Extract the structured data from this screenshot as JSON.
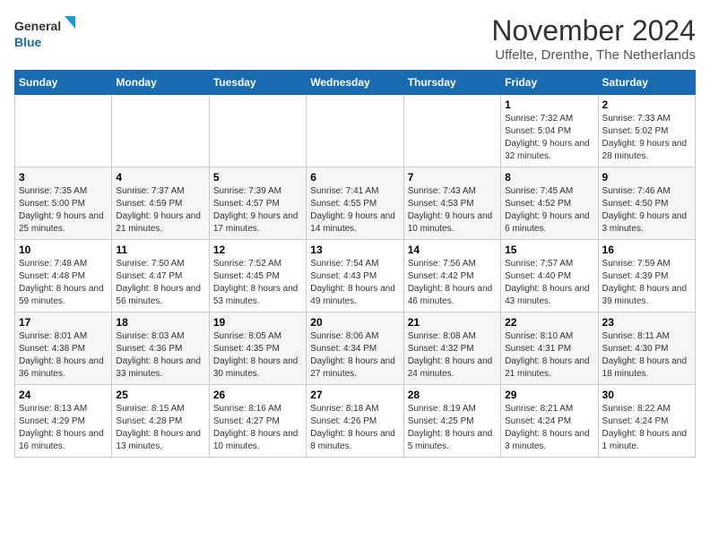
{
  "logo": {
    "line1": "General",
    "line2": "Blue"
  },
  "title": "November 2024",
  "location": "Uffelte, Drenthe, The Netherlands",
  "days_of_week": [
    "Sunday",
    "Monday",
    "Tuesday",
    "Wednesday",
    "Thursday",
    "Friday",
    "Saturday"
  ],
  "weeks": [
    [
      {
        "day": "",
        "info": ""
      },
      {
        "day": "",
        "info": ""
      },
      {
        "day": "",
        "info": ""
      },
      {
        "day": "",
        "info": ""
      },
      {
        "day": "",
        "info": ""
      },
      {
        "day": "1",
        "info": "Sunrise: 7:32 AM\nSunset: 5:04 PM\nDaylight: 9 hours and 32 minutes."
      },
      {
        "day": "2",
        "info": "Sunrise: 7:33 AM\nSunset: 5:02 PM\nDaylight: 9 hours and 28 minutes."
      }
    ],
    [
      {
        "day": "3",
        "info": "Sunrise: 7:35 AM\nSunset: 5:00 PM\nDaylight: 9 hours and 25 minutes."
      },
      {
        "day": "4",
        "info": "Sunrise: 7:37 AM\nSunset: 4:59 PM\nDaylight: 9 hours and 21 minutes."
      },
      {
        "day": "5",
        "info": "Sunrise: 7:39 AM\nSunset: 4:57 PM\nDaylight: 9 hours and 17 minutes."
      },
      {
        "day": "6",
        "info": "Sunrise: 7:41 AM\nSunset: 4:55 PM\nDaylight: 9 hours and 14 minutes."
      },
      {
        "day": "7",
        "info": "Sunrise: 7:43 AM\nSunset: 4:53 PM\nDaylight: 9 hours and 10 minutes."
      },
      {
        "day": "8",
        "info": "Sunrise: 7:45 AM\nSunset: 4:52 PM\nDaylight: 9 hours and 6 minutes."
      },
      {
        "day": "9",
        "info": "Sunrise: 7:46 AM\nSunset: 4:50 PM\nDaylight: 9 hours and 3 minutes."
      }
    ],
    [
      {
        "day": "10",
        "info": "Sunrise: 7:48 AM\nSunset: 4:48 PM\nDaylight: 8 hours and 59 minutes."
      },
      {
        "day": "11",
        "info": "Sunrise: 7:50 AM\nSunset: 4:47 PM\nDaylight: 8 hours and 56 minutes."
      },
      {
        "day": "12",
        "info": "Sunrise: 7:52 AM\nSunset: 4:45 PM\nDaylight: 8 hours and 53 minutes."
      },
      {
        "day": "13",
        "info": "Sunrise: 7:54 AM\nSunset: 4:43 PM\nDaylight: 8 hours and 49 minutes."
      },
      {
        "day": "14",
        "info": "Sunrise: 7:56 AM\nSunset: 4:42 PM\nDaylight: 8 hours and 46 minutes."
      },
      {
        "day": "15",
        "info": "Sunrise: 7:57 AM\nSunset: 4:40 PM\nDaylight: 8 hours and 43 minutes."
      },
      {
        "day": "16",
        "info": "Sunrise: 7:59 AM\nSunset: 4:39 PM\nDaylight: 8 hours and 39 minutes."
      }
    ],
    [
      {
        "day": "17",
        "info": "Sunrise: 8:01 AM\nSunset: 4:38 PM\nDaylight: 8 hours and 36 minutes."
      },
      {
        "day": "18",
        "info": "Sunrise: 8:03 AM\nSunset: 4:36 PM\nDaylight: 8 hours and 33 minutes."
      },
      {
        "day": "19",
        "info": "Sunrise: 8:05 AM\nSunset: 4:35 PM\nDaylight: 8 hours and 30 minutes."
      },
      {
        "day": "20",
        "info": "Sunrise: 8:06 AM\nSunset: 4:34 PM\nDaylight: 8 hours and 27 minutes."
      },
      {
        "day": "21",
        "info": "Sunrise: 8:08 AM\nSunset: 4:32 PM\nDaylight: 8 hours and 24 minutes."
      },
      {
        "day": "22",
        "info": "Sunrise: 8:10 AM\nSunset: 4:31 PM\nDaylight: 8 hours and 21 minutes."
      },
      {
        "day": "23",
        "info": "Sunrise: 8:11 AM\nSunset: 4:30 PM\nDaylight: 8 hours and 18 minutes."
      }
    ],
    [
      {
        "day": "24",
        "info": "Sunrise: 8:13 AM\nSunset: 4:29 PM\nDaylight: 8 hours and 16 minutes."
      },
      {
        "day": "25",
        "info": "Sunrise: 8:15 AM\nSunset: 4:28 PM\nDaylight: 8 hours and 13 minutes."
      },
      {
        "day": "26",
        "info": "Sunrise: 8:16 AM\nSunset: 4:27 PM\nDaylight: 8 hours and 10 minutes."
      },
      {
        "day": "27",
        "info": "Sunrise: 8:18 AM\nSunset: 4:26 PM\nDaylight: 8 hours and 8 minutes."
      },
      {
        "day": "28",
        "info": "Sunrise: 8:19 AM\nSunset: 4:25 PM\nDaylight: 8 hours and 5 minutes."
      },
      {
        "day": "29",
        "info": "Sunrise: 8:21 AM\nSunset: 4:24 PM\nDaylight: 8 hours and 3 minutes."
      },
      {
        "day": "30",
        "info": "Sunrise: 8:22 AM\nSunset: 4:24 PM\nDaylight: 8 hours and 1 minute."
      }
    ]
  ]
}
